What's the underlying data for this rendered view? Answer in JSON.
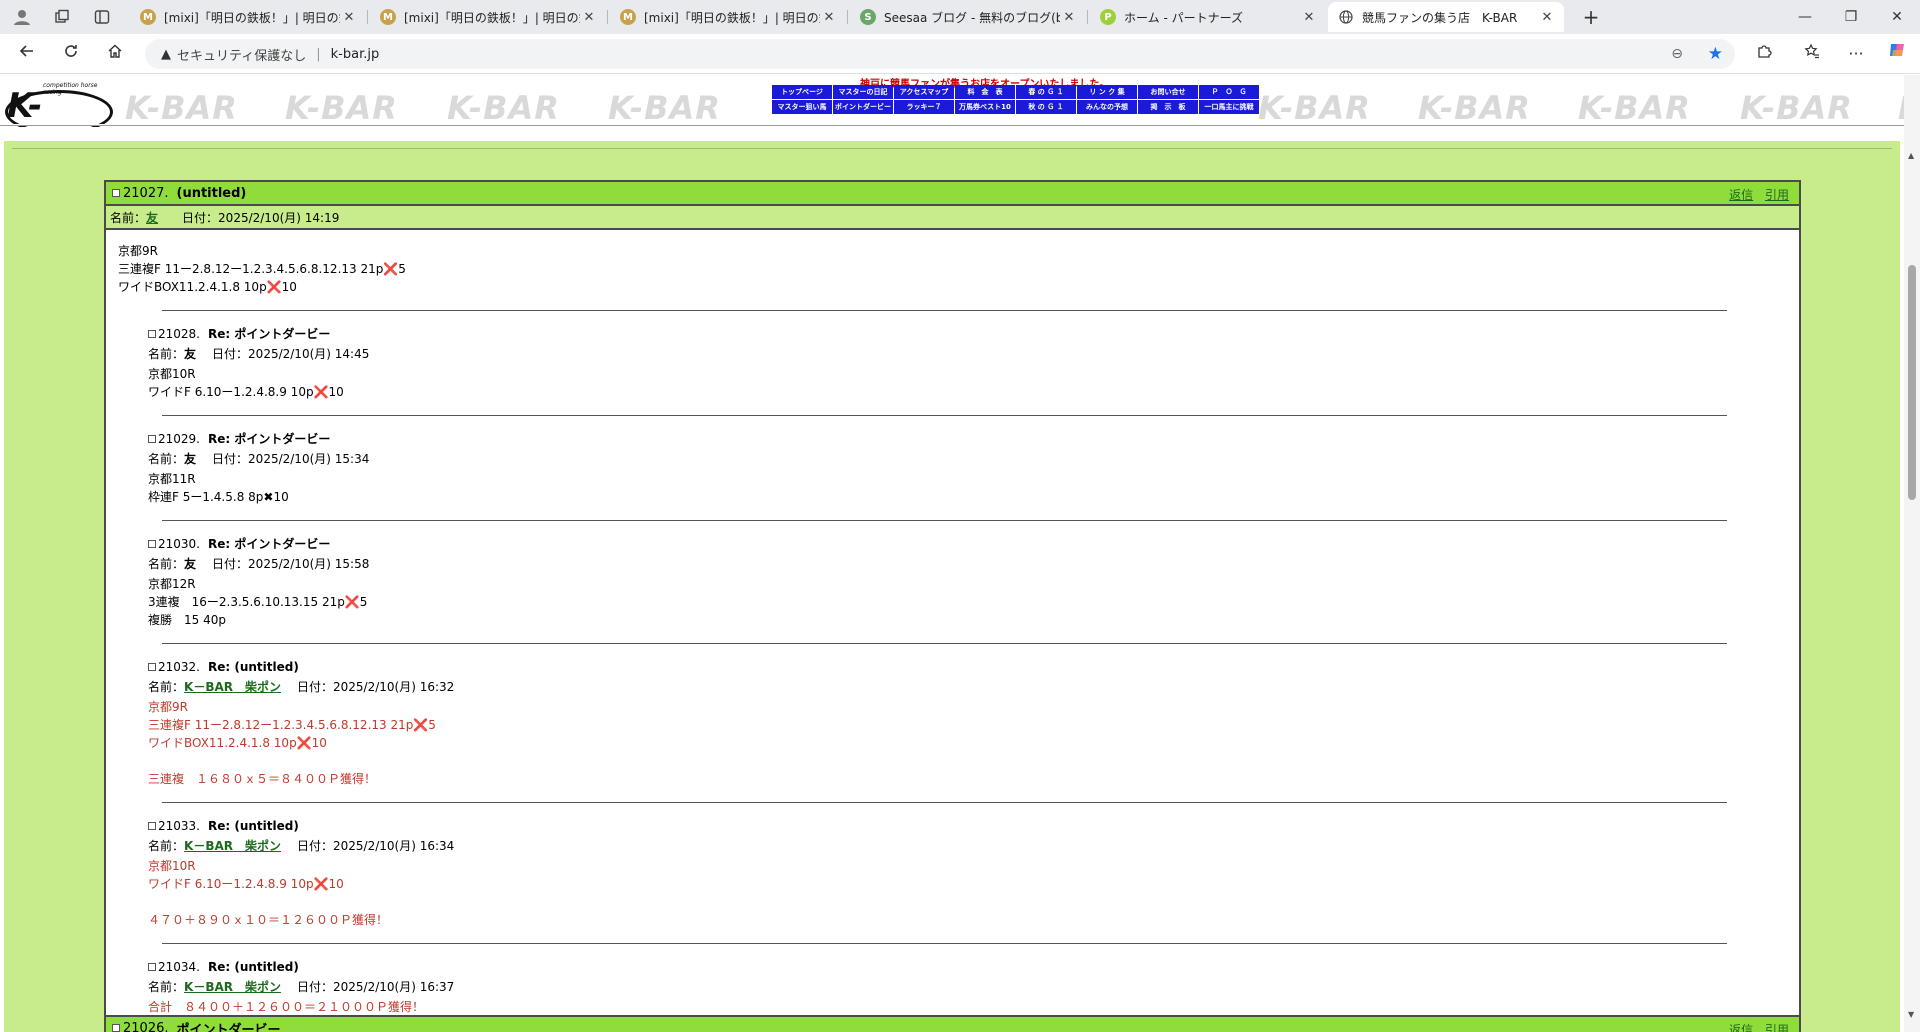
{
  "browser": {
    "tabs": [
      {
        "title": "[mixi]「明日の鉄板！」| 明日の鉄板",
        "favicon": "M",
        "favicon_color": "#c9a14b"
      },
      {
        "title": "[mixi]「明日の鉄板！」| 明日の鉄板",
        "favicon": "M",
        "favicon_color": "#c9a14b"
      },
      {
        "title": "[mixi]「明日の鉄板！」| 明日の鉄板",
        "favicon": "M",
        "favicon_color": "#c9a14b"
      },
      {
        "title": "Seesaa ブログ - 無料のブログ(blog)サ",
        "favicon": "S",
        "favicon_color": "#6aa86a"
      },
      {
        "title": "ホーム - パートナーズ",
        "favicon": "P",
        "favicon_color": "#9bd23a"
      },
      {
        "title": "競馬ファンの集う店　K-BAR",
        "favicon": "globe",
        "favicon_color": "#444444"
      }
    ],
    "close_glyph": "✕",
    "new_tab_glyph": "+",
    "window": {
      "minimize": "—",
      "restore": "❐",
      "close": "✕"
    },
    "address": {
      "security_label": "セキュリティ保護なし",
      "url": "k-bar.jp"
    }
  },
  "site": {
    "logo_text": "K-BAR",
    "logo_small": "competition horse racing",
    "watermark_text": "K-BAR",
    "announcement": "神戸に競馬ファンが集うお店をオープンいたしました。",
    "nav_row1": [
      "トップページ",
      "マスターの日記",
      "アクセスマップ",
      "料　金　表",
      "春 の Ｇ １",
      "リ ン ク 集",
      "お問い合せ",
      "Ｐ　Ｏ　Ｇ"
    ],
    "nav_row2": [
      "マスター狙い馬",
      "ポイントダービー",
      "ラッキー７",
      "万馬券ベスト10",
      "秋 の Ｇ １",
      "みんなの予想",
      "掲　示　板",
      "一口馬主に挑戦"
    ]
  },
  "thread": {
    "number": "21027.",
    "title": "(untitled)",
    "reply_label": "返信",
    "quote_label": "引用",
    "name_label": "名前：",
    "name": "友",
    "date_label": "日付：",
    "date": "2025/2/10(月) 14:19",
    "body": [
      "京都9R",
      "三連複F 11ー2.8.12ー1.2.3.4.5.6.8.12.13 21p❌5",
      "ワイドBOX11.2.4.1.8 10p❌10"
    ]
  },
  "replies": [
    {
      "number": "21028.",
      "title": "Re: ポイントダービー",
      "name": "友",
      "name_is_link": false,
      "date": "2025/2/10(月) 14:45",
      "red": false,
      "lines": [
        "京都10R",
        "ワイドF 6.10ー1.2.4.8.9 10p❌10"
      ]
    },
    {
      "number": "21029.",
      "title": "Re: ポイントダービー",
      "name": "友",
      "name_is_link": false,
      "date": "2025/2/10(月) 15:34",
      "red": false,
      "lines": [
        "京都11R",
        "枠連F 5ー1.4.5.8 8p✖10"
      ]
    },
    {
      "number": "21030.",
      "title": "Re: ポイントダービー",
      "name": "友",
      "name_is_link": false,
      "date": "2025/2/10(月) 15:58",
      "red": false,
      "lines": [
        "京都12R",
        "3連複　16ー2.3.5.6.10.13.15 21p❌5",
        "複勝　15 40p"
      ]
    },
    {
      "number": "21032.",
      "title": "Re: (untitled)",
      "name": "K－BAR　柴ポン",
      "name_is_link": true,
      "date": "2025/2/10(月) 16:32",
      "red": true,
      "lines": [
        "京都9R",
        "三連複F 11ー2.8.12ー1.2.3.4.5.6.8.12.13 21p❌5",
        "ワイドBOX11.2.4.1.8 10p❌10",
        "",
        "三連複　１６８０ｘ５＝８４００Ｐ獲得！"
      ]
    },
    {
      "number": "21033.",
      "title": "Re: (untitled)",
      "name": "K－BAR　柴ポン",
      "name_is_link": true,
      "date": "2025/2/10(月) 16:34",
      "red": true,
      "lines": [
        "京都10R",
        "ワイドF 6.10ー1.2.4.8.9 10p❌10",
        "",
        "４７０＋８９０ｘ１０＝１２６００Ｐ獲得！"
      ]
    },
    {
      "number": "21034.",
      "title": "Re: (untitled)",
      "name": "K－BAR　柴ポン",
      "name_is_link": true,
      "date": "2025/2/10(月) 16:37",
      "red": true,
      "lines": [
        "合計　８４００＋１２６００＝２１０００Ｐ獲得！"
      ]
    }
  ],
  "next_thread": {
    "number": "21026.",
    "title": "ポイントダービー",
    "reply_label": "返信",
    "quote_label": "引用"
  },
  "colors": {
    "board_bg": "#c8eb8c",
    "title_bar": "#8fdc3a",
    "nav_blue": "#1a1ad8",
    "link_green": "#1d6a1d",
    "reply_red": "#c0392b",
    "announce_red": "#cc0000"
  }
}
